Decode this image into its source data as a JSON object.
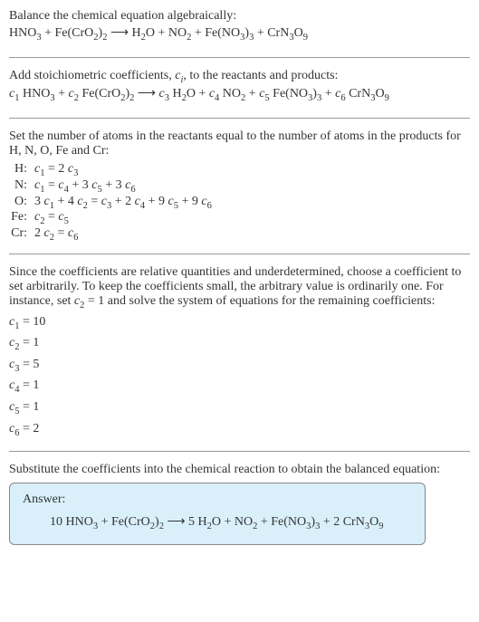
{
  "intro": {
    "line1": "Balance the chemical equation algebraically:",
    "eq_lhs1": "HNO",
    "eq_lhs2": " + Fe(CrO",
    "eq_lhs3": ")",
    "eq_arrow": " ⟶ H",
    "eq_rhs1": "O + NO",
    "eq_rhs2": " + Fe(NO",
    "eq_rhs3": ")",
    "eq_rhs4": " + CrN",
    "eq_rhs5": "O"
  },
  "stoich": {
    "line1_a": "Add stoichiometric coefficients, ",
    "line1_c": "c",
    "line1_i": "i",
    "line1_b": ", to the reactants and products:",
    "c1": "c",
    "hno3": " HNO",
    "plus": " + ",
    "fecro2": " Fe(CrO",
    "paren2": ")",
    "arrow": " ⟶ ",
    "h2o_h": " H",
    "h2o_o": "O + ",
    "no2_n": " NO",
    "feno3_f": " Fe(NO",
    "feno3_p": ")",
    "crn_c": " CrN",
    "crn_o": "O"
  },
  "setnum": {
    "text": "Set the number of atoms in the reactants equal to the number of atoms in the products for H, N, O, Fe and Cr:"
  },
  "atoms": {
    "H_label": "H:",
    "H_eq_a": "c",
    "H_eq_b": " = 2 ",
    "H_eq_c": "c",
    "N_label": "N:",
    "N_a": "c",
    "N_b": " = ",
    "N_c": "c",
    "N_d": " + 3 ",
    "N_e": "c",
    "N_f": " + 3 ",
    "N_g": "c",
    "O_label": "O:",
    "O_a": "3 ",
    "O_b": "c",
    "O_c": " + 4 ",
    "O_d": "c",
    "O_e": " = ",
    "O_f": "c",
    "O_g": " + 2 ",
    "O_h": "c",
    "O_i": " + 9 ",
    "O_j": "c",
    "O_k": " + 9 ",
    "O_l": "c",
    "Fe_label": "Fe:",
    "Fe_a": "c",
    "Fe_b": " = ",
    "Fe_c": "c",
    "Cr_label": "Cr:",
    "Cr_a": "2 ",
    "Cr_b": "c",
    "Cr_c": " = ",
    "Cr_d": "c"
  },
  "since": {
    "text_a": "Since the coefficients are relative quantities and underdetermined, choose a coefficient to set arbitrarily. To keep the coefficients small, the arbitrary value is ordinarily one. For instance, set ",
    "c": "c",
    "text_b": " = 1 and solve the system of equations for the remaining coefficients:"
  },
  "coeffs": {
    "c1_a": "c",
    "c1_b": " = 10",
    "c2_a": "c",
    "c2_b": " = 1",
    "c3_a": "c",
    "c3_b": " = 5",
    "c4_a": "c",
    "c4_b": " = 1",
    "c5_a": "c",
    "c5_b": " = 1",
    "c6_a": "c",
    "c6_b": " = 2"
  },
  "subst": {
    "text": "Substitute the coefficients into the chemical reaction to obtain the balanced equation:"
  },
  "answer": {
    "label": "Answer:",
    "a": "10 HNO",
    "b": " + Fe(CrO",
    "c": ")",
    "arrow": " ⟶ 5 H",
    "d": "O + NO",
    "e": " + Fe(NO",
    "f": ")",
    "g": " + 2 CrN",
    "h": "O"
  },
  "sub": {
    "1": "1",
    "2": "2",
    "3": "3",
    "4": "4",
    "5": "5",
    "6": "6",
    "9": "9"
  }
}
